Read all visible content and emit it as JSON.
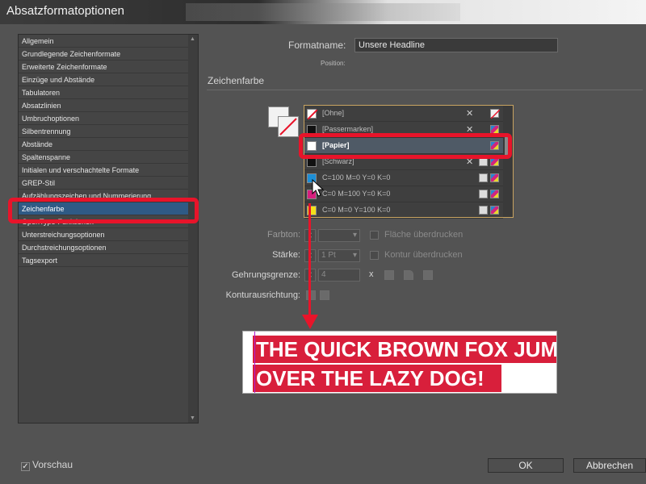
{
  "window": {
    "title": "Absatzformatoptionen"
  },
  "sidebar": {
    "items": [
      "Allgemein",
      "Grundlegende Zeichenformate",
      "Erweiterte Zeichenformate",
      "Einzüge und Abstände",
      "Tabulatoren",
      "Absatzlinien",
      "Umbruchoptionen",
      "Silbentrennung",
      "Abstände",
      "Spaltenspanne",
      "Initialen und verschachtelte Formate",
      "GREP-Stil",
      "Aufzählungszeichen und Nummerierung",
      "Zeichenfarbe",
      "OpenType-Funktionen",
      "Unterstreichungsoptionen",
      "Durchstreichungsoptionen",
      "Tagsexport"
    ],
    "selected": "Zeichenfarbe"
  },
  "header": {
    "formatname_label": "Formatname:",
    "formatname_value": "Unsere Headline",
    "position_label": "Position:"
  },
  "section": {
    "title": "Zeichenfarbe"
  },
  "swatches": [
    {
      "name": "[Ohne]",
      "color": "#ffffff"
    },
    {
      "name": "[Passermarken]",
      "color": "#111111"
    },
    {
      "name": "[Papier]",
      "color": "#ffffff"
    },
    {
      "name": "[Schwarz]",
      "color": "#111111"
    },
    {
      "name": "C=100 M=0 Y=0 K=0",
      "color": "#1d8fd6"
    },
    {
      "name": "C=0 M=100 Y=0 K=0",
      "color": "#d81f7e"
    },
    {
      "name": "C=0 M=0 Y=100 K=0",
      "color": "#f3e01a"
    }
  ],
  "controls": {
    "farbton_label": "Farbton:",
    "staerke_label": "Stärke:",
    "staerke_value": "1 Pt",
    "gehrung_label": "Gehrungsgrenze:",
    "gehrung_value": "4",
    "gehrung_x": "x",
    "kontur_label": "Konturausrichtung:",
    "flaeche_label": "Fläche überdrucken",
    "kontur_ueber_label": "Kontur überdrucken"
  },
  "preview_text": {
    "line1": "THE QUICK BROWN FOX JUMPS",
    "line2": "OVER THE LAZY DOG!"
  },
  "footer": {
    "vorschau_label": "Vorschau",
    "vorschau_checked": true,
    "ok_label": "OK",
    "cancel_label": "Abbrechen"
  },
  "colors": {
    "highlight": "#e8142a",
    "selection": "#2f5a85",
    "text_bg": "#d81f3b"
  }
}
